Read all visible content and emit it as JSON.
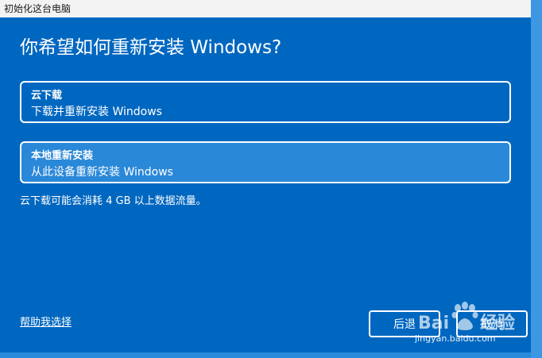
{
  "window": {
    "title": "初始化这台电脑"
  },
  "page": {
    "heading": "你希望如何重新安装 Windows?"
  },
  "options": [
    {
      "title": "云下载",
      "description": "下载并重新安装 Windows",
      "selected": false
    },
    {
      "title": "本地重新安装",
      "description": "从此设备重新安装 Windows",
      "selected": true
    }
  ],
  "note": "云下载可能会消耗 4 GB 以上数据流量。",
  "footer": {
    "help_link": "帮助我选择",
    "back_label": "后退",
    "cancel_label": "取消"
  },
  "watermark": {
    "brand": "Baidu 经验",
    "url": "jingyan.baidu.com"
  },
  "colors": {
    "background": "#0067c0",
    "selected_option": "#2a88d8",
    "titlebar": "#f3f3f3"
  }
}
